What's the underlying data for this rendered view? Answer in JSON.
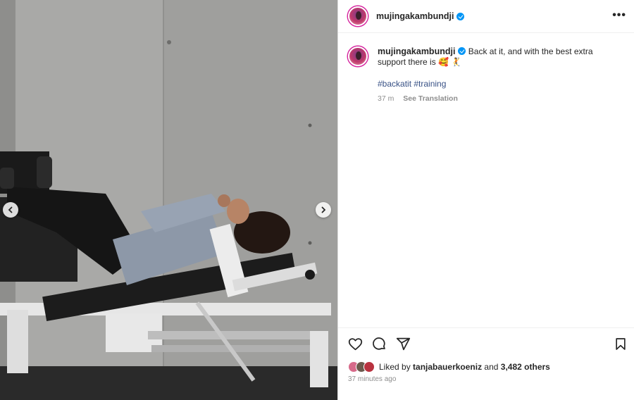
{
  "post": {
    "username": "mujingakambundji",
    "more_label": "•••",
    "caption_text": "Back at it, and with the best extra support there is 🥰 🤾",
    "hashtags": [
      "#backatit",
      "#training"
    ],
    "time": "37 m",
    "see_translation": "See Translation",
    "liked_prefix": "Liked by",
    "liked_user": "tanjabauerkoeniz",
    "liked_and": "and",
    "liked_others": "3,482 others",
    "time_ago": "37 minutes ago"
  },
  "icons": {
    "like": "heart-icon",
    "comment": "comment-icon",
    "share": "send-icon",
    "save": "bookmark-icon",
    "prev": "chevron-left-icon",
    "next": "chevron-right-icon",
    "verified": "verified-badge-icon"
  },
  "colors": {
    "link": "#385185",
    "verified": "#0095f6",
    "text": "#262626",
    "muted": "#8e8e8e"
  }
}
